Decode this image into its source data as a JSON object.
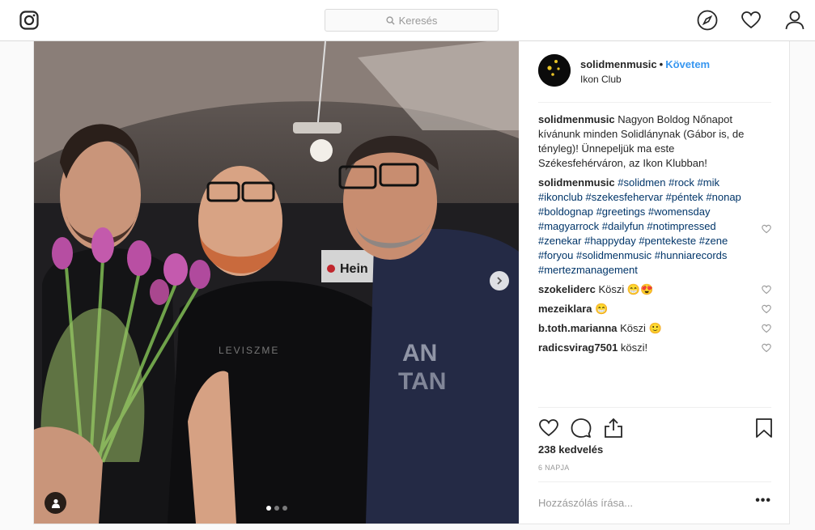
{
  "topbar": {
    "search_placeholder": "Keresés",
    "logo_icon": "instagram-icon",
    "icons": [
      "compass-icon",
      "heart-icon",
      "profile-icon"
    ]
  },
  "post": {
    "author": "solidmenmusic",
    "separator": "•",
    "follow_label": "Követem",
    "location": "Ikon Club",
    "caption": {
      "user": "solidmenmusic",
      "text": "Nagyon Boldog Nőnapot kívánunk minden Solidlánynak (Gábor is, de tényleg)! Ünnepeljük ma este Székesfehérváron, az Ikon Klubban!"
    },
    "hashtag_comment": {
      "user": "solidmenmusic",
      "text": "#solidmen #rock #mik #ikonclub #szekesfehervar #péntek #nonap #boldognap #greetings #womensday #magyarrock #dailyfun #notimpressed #zenekar #happyday #pentekeste #zene #foryou #solidmenmusic #hunniarecords #mertezmanagement"
    },
    "comments": [
      {
        "user": "szokeliderc",
        "text": "Köszi 😁😍"
      },
      {
        "user": "mezeiklara",
        "text": "😁"
      },
      {
        "user": "b.toth.marianna",
        "text": "Köszi 🙂"
      },
      {
        "user": "radicsvirag7501",
        "text": "köszi!"
      }
    ],
    "likes": "238 kedvelés",
    "time": "6 NAPJA",
    "add_comment_placeholder": "Hozzászólás írása...",
    "more_label": "•••",
    "carousel": {
      "current": 1,
      "total": 3
    }
  },
  "colors": {
    "accent": "#3897f0",
    "hashtag": "#003569",
    "border": "#dbdbdb"
  }
}
